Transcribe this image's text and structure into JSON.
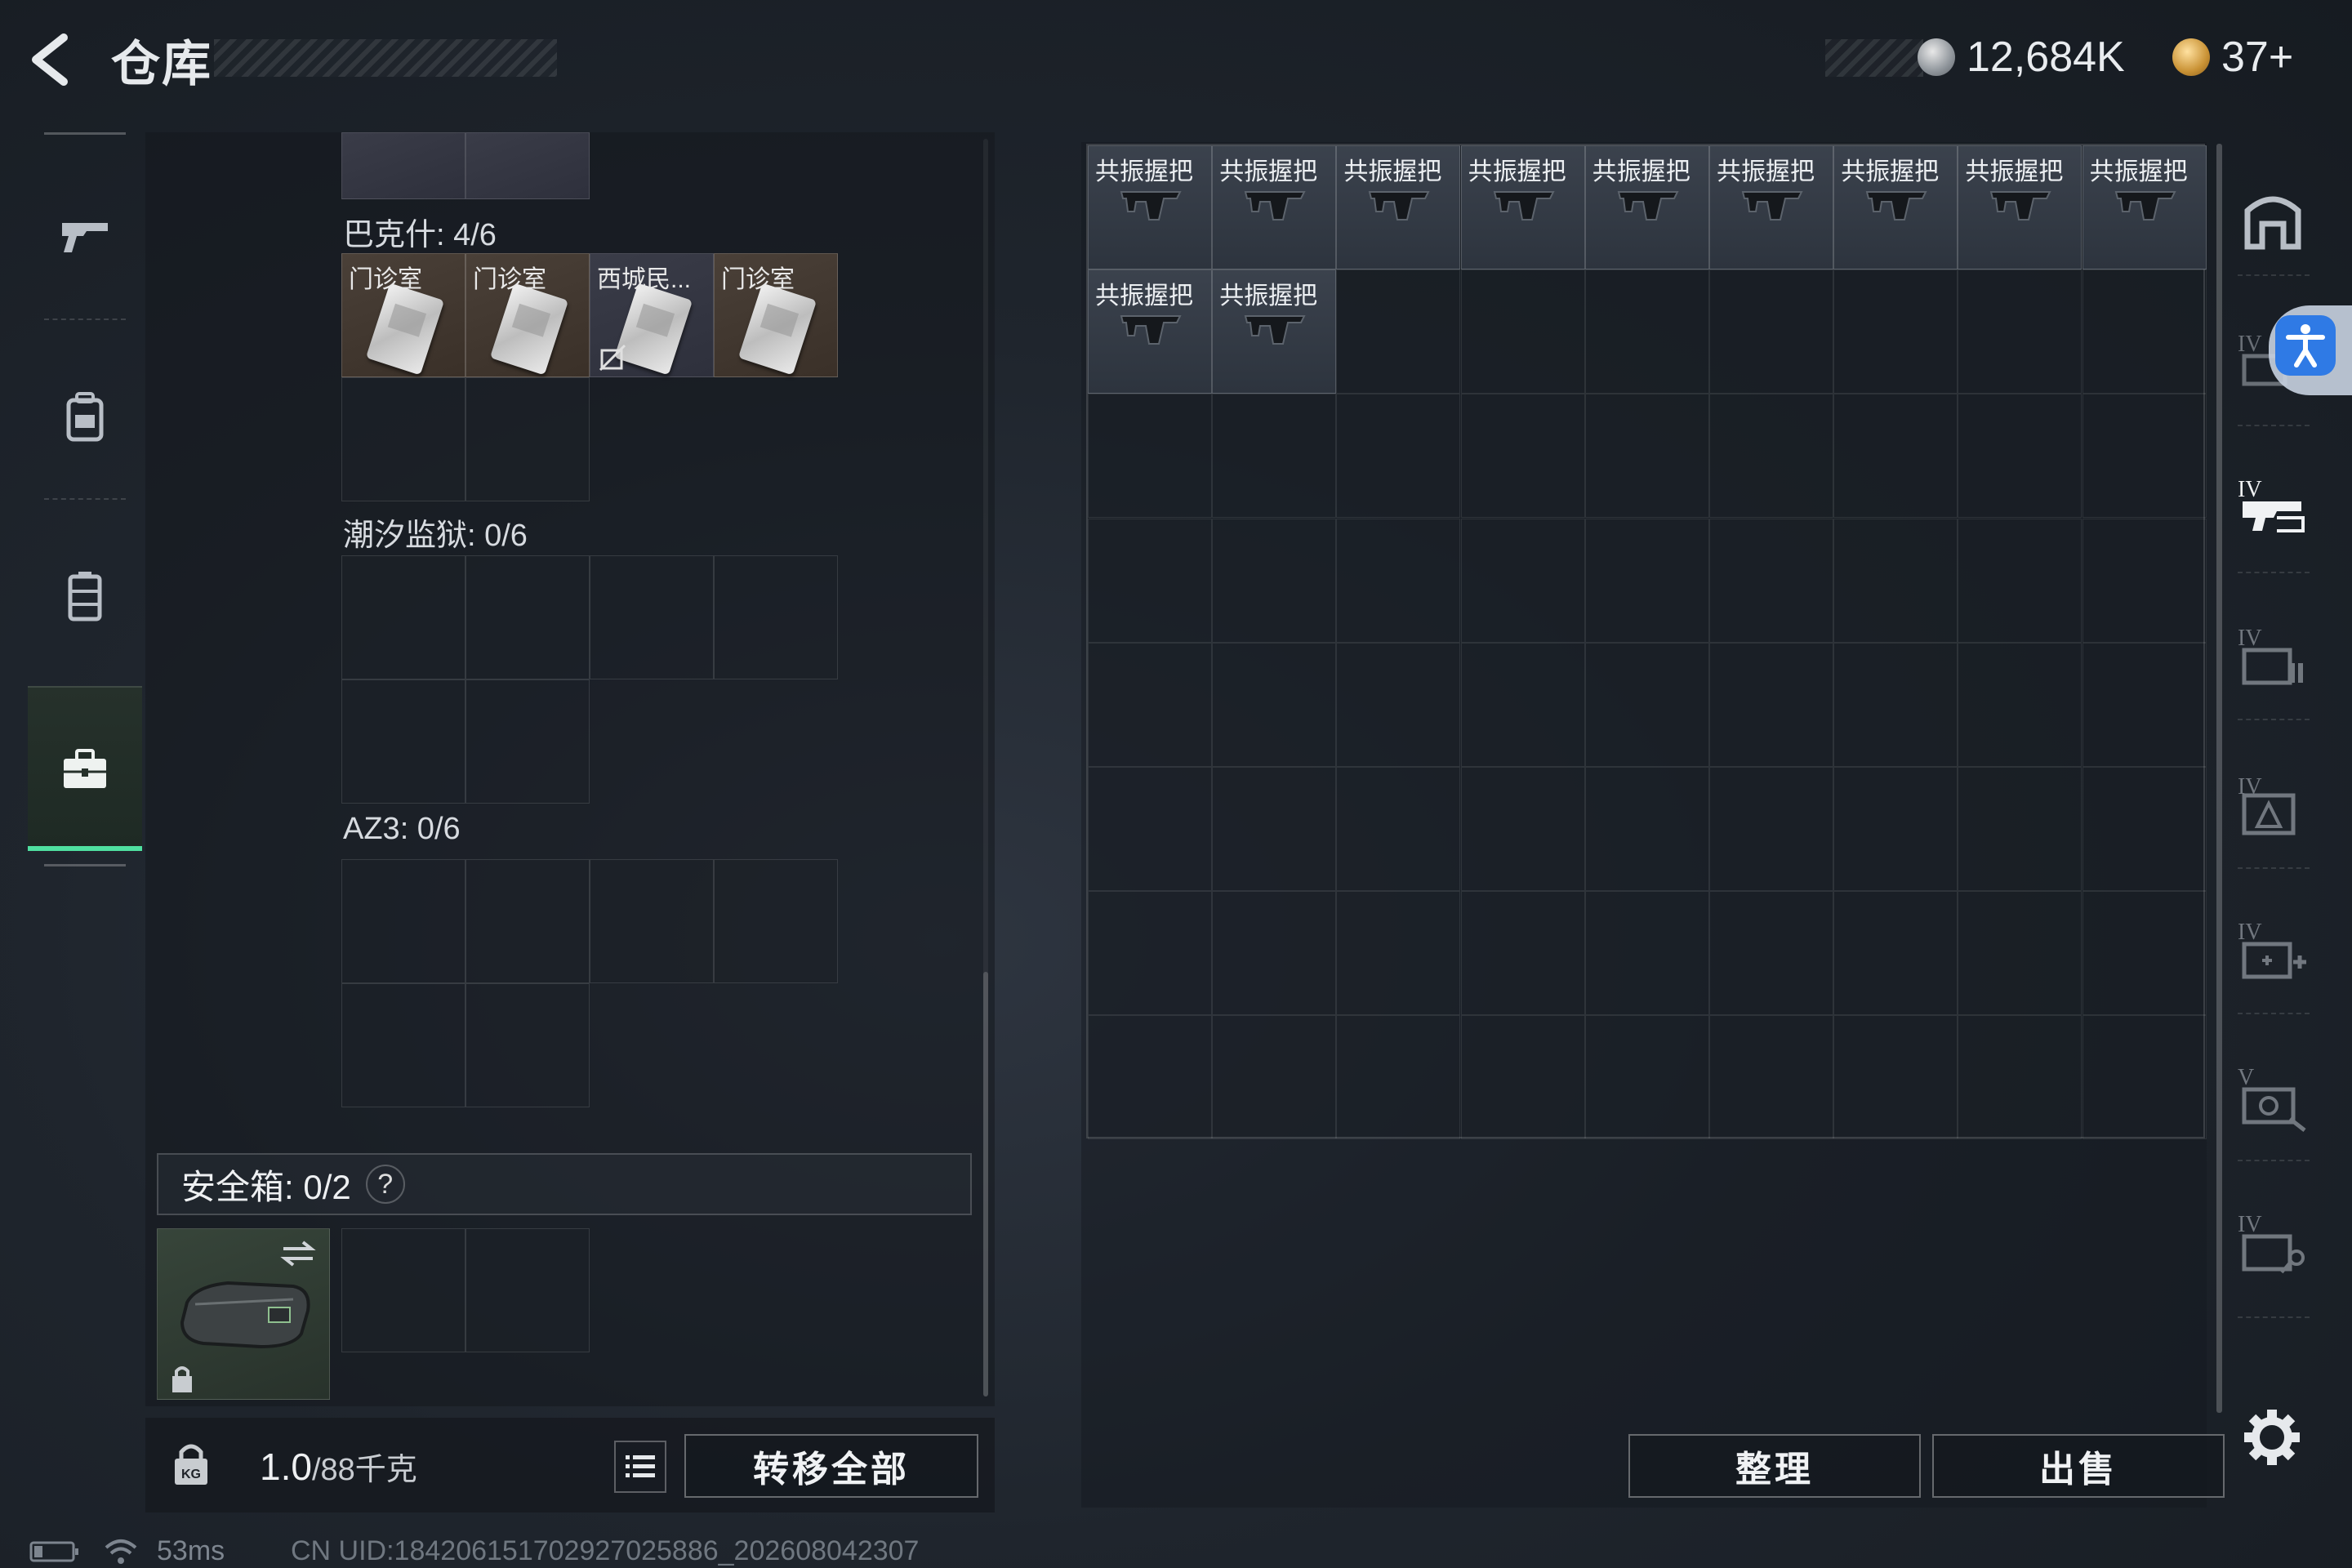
{
  "header": {
    "title": "仓库"
  },
  "currency": [
    {
      "name": "coin-silver-icon",
      "value": "12,684K"
    },
    {
      "name": "coin-gold-icon",
      "value": "37+"
    }
  ],
  "left_nav": [
    "weapon-tab",
    "backpack-tab",
    "vest-tab",
    "case-tab"
  ],
  "sections": [
    {
      "label": "巴克什: 4/6",
      "items": [
        "门诊室",
        "门诊室",
        "西城民...",
        "门诊室"
      ]
    },
    {
      "label": "潮汐监狱: 0/6"
    },
    {
      "label": "AZ3: 0/6"
    }
  ],
  "safe": {
    "label": "安全箱: 0/2",
    "help": "?"
  },
  "weight": {
    "value": "1.0",
    "unit": "/88千克"
  },
  "buttons": {
    "transfer_all": "转移全部",
    "sort": "整理",
    "sell": "出售"
  },
  "grid": {
    "rows": 8,
    "cols": 9,
    "items": [
      "共振握把",
      "共振握把",
      "共振握把",
      "共振握把",
      "共振握把",
      "共振握把",
      "共振握把",
      "共振握把",
      "共振握把",
      "共振握把",
      "共振握把"
    ]
  },
  "status": {
    "ping": "53ms",
    "uid": "CN UID:184206151702927025886_202608042307"
  }
}
